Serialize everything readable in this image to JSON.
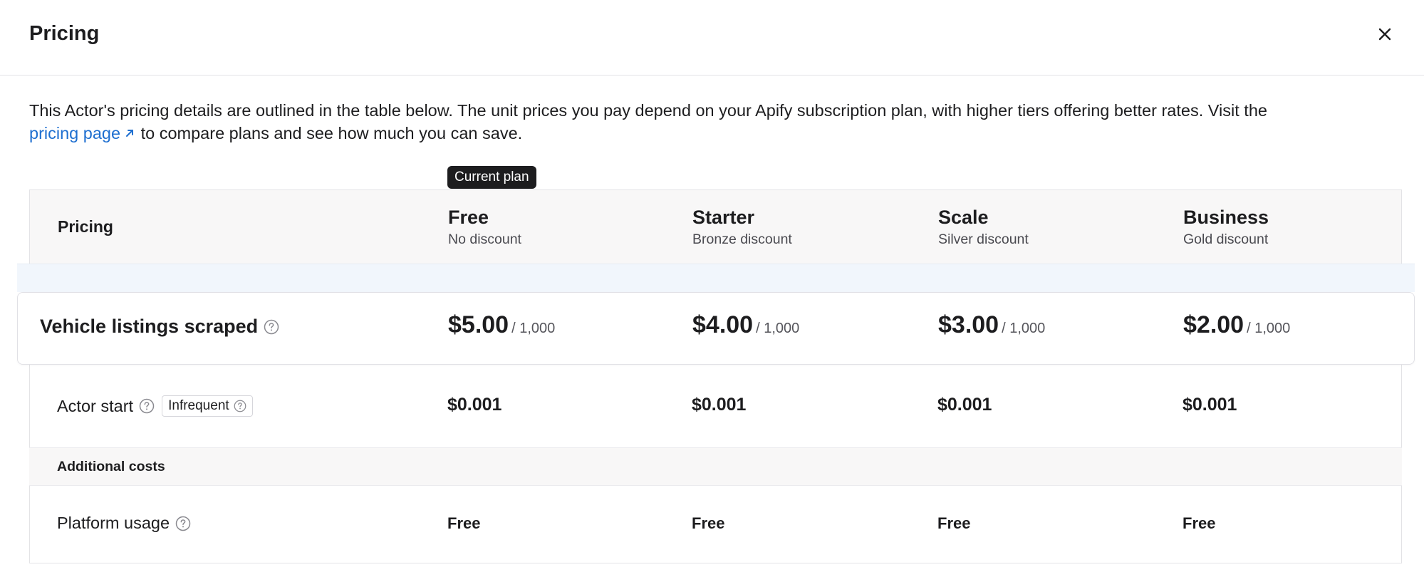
{
  "header": {
    "title": "Pricing",
    "close_icon": "close-icon"
  },
  "intro": {
    "text_before": "This Actor's pricing details are outlined in the table below. The unit prices you pay depend on your Apify subscription plan, with higher tiers offering better rates. Visit the",
    "link_label": "pricing page",
    "text_after": " to compare plans and see how much you can save."
  },
  "current_plan_badge": "Current plan",
  "table": {
    "header_label": "Pricing",
    "plans": [
      {
        "name": "Free",
        "discount": "No discount"
      },
      {
        "name": "Starter",
        "discount": "Bronze discount"
      },
      {
        "name": "Scale",
        "discount": "Silver discount"
      },
      {
        "name": "Business",
        "discount": "Gold discount"
      }
    ],
    "rows": {
      "vehicle": {
        "label": "Vehicle listings scraped",
        "per": "/ 1,000",
        "prices": [
          "$5.00",
          "$4.00",
          "$3.00",
          "$2.00"
        ]
      },
      "actor_start": {
        "label": "Actor start",
        "badge": "Infrequent",
        "prices": [
          "$0.001",
          "$0.001",
          "$0.001",
          "$0.001"
        ]
      },
      "additional_costs": {
        "label": "Additional costs"
      },
      "platform_usage": {
        "label": "Platform usage",
        "prices": [
          "Free",
          "Free",
          "Free",
          "Free"
        ]
      }
    }
  },
  "colors": {
    "link": "#1e6fd0",
    "badge_bg": "#1d1d1f",
    "highlight": "#f1f6fc"
  }
}
